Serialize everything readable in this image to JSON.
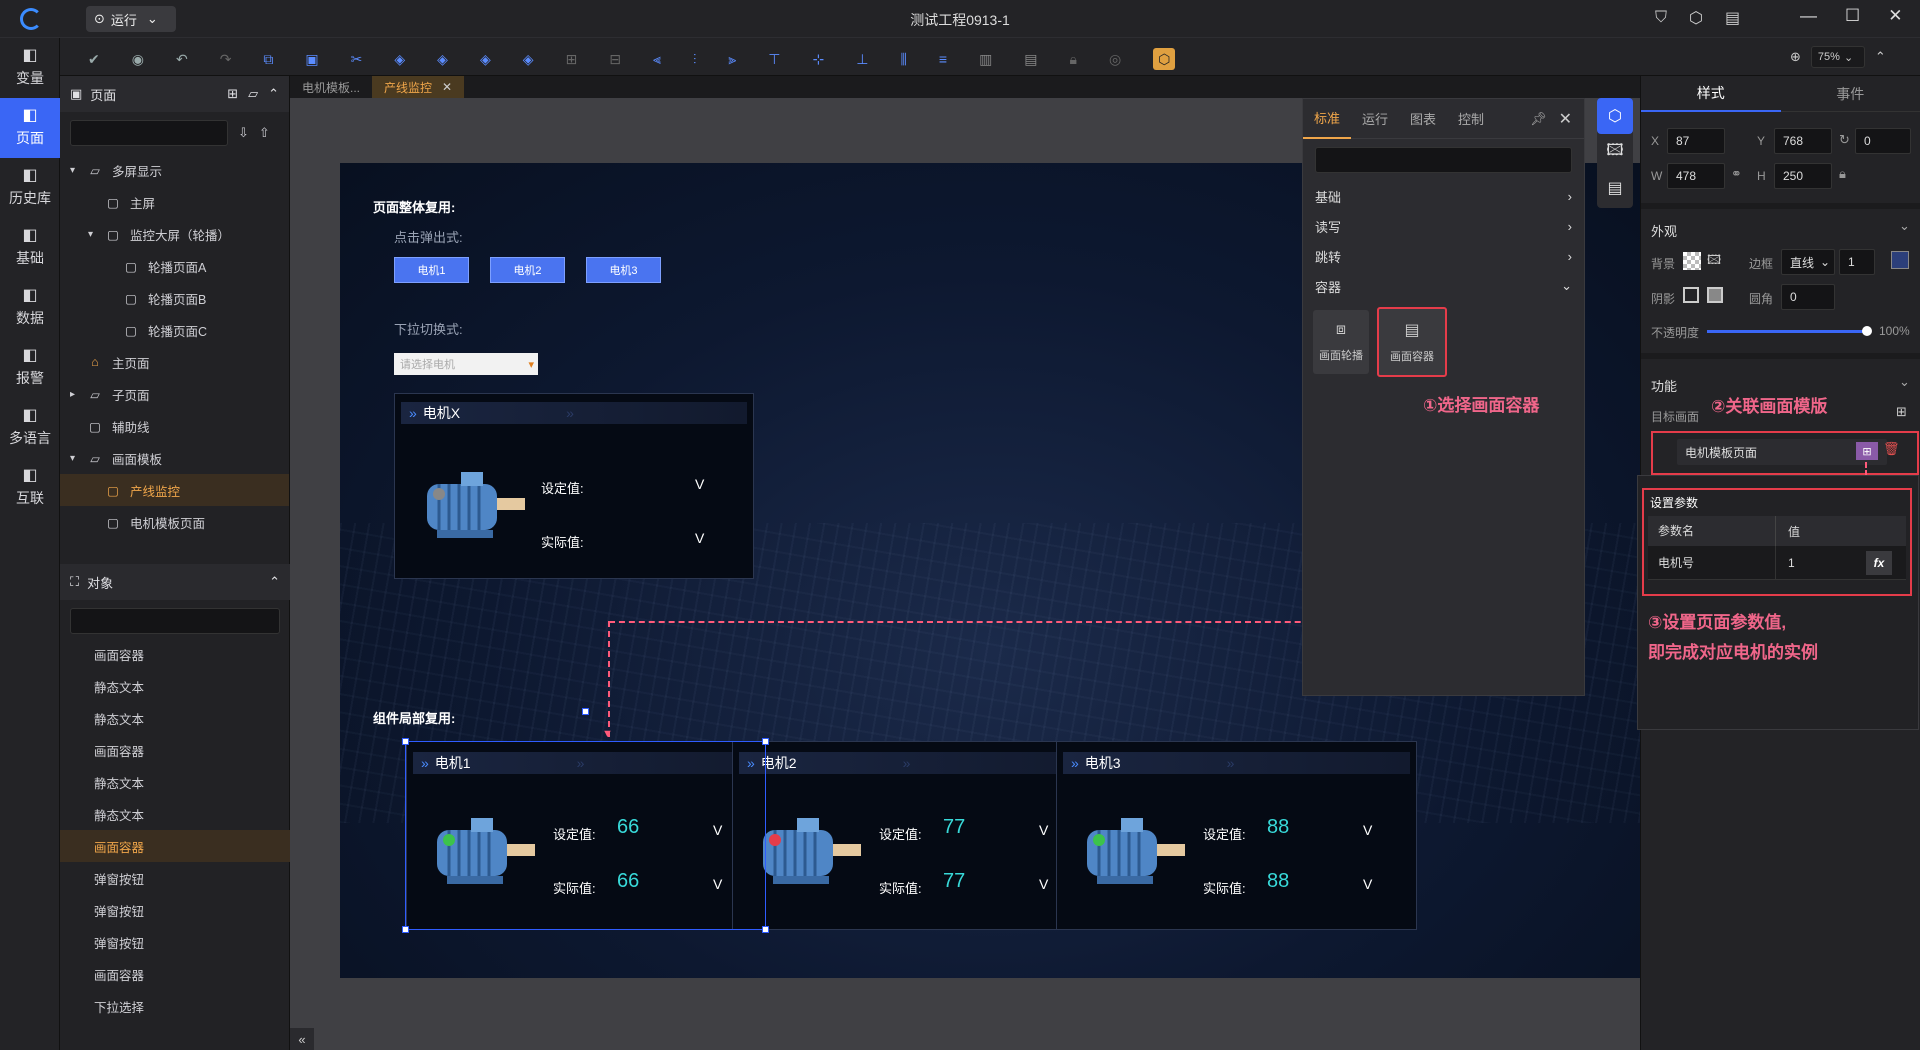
{
  "window": {
    "title": "测试工程0913-1",
    "run_label": "运行",
    "zoom": "75%"
  },
  "leftnav": [
    {
      "icon": "variable-icon",
      "label": "变量"
    },
    {
      "icon": "page-icon",
      "label": "页面",
      "active": true
    },
    {
      "icon": "history-icon",
      "label": "历史库"
    },
    {
      "icon": "basic-icon",
      "label": "基础"
    },
    {
      "icon": "data-icon",
      "label": "数据"
    },
    {
      "icon": "alarm-icon",
      "label": "报警"
    },
    {
      "icon": "language-icon",
      "label": "多语言"
    },
    {
      "icon": "connect-icon",
      "label": "互联"
    }
  ],
  "pages_panel": {
    "title": "页面",
    "tree": [
      {
        "label": "多屏显示",
        "level": 0,
        "arrow": "▾",
        "icon": "folder"
      },
      {
        "label": "主屏",
        "level": 1,
        "arrow": "",
        "icon": "page"
      },
      {
        "label": "监控大屏（轮播）",
        "level": 1,
        "arrow": "▾",
        "icon": "page"
      },
      {
        "label": "轮播页面A",
        "level": 2,
        "arrow": "",
        "icon": "page"
      },
      {
        "label": "轮播页面B",
        "level": 2,
        "arrow": "",
        "icon": "page"
      },
      {
        "label": "轮播页面C",
        "level": 2,
        "arrow": "",
        "icon": "page"
      },
      {
        "label": "主页面",
        "level": 0,
        "arrow": "",
        "icon": "home"
      },
      {
        "label": "子页面",
        "level": 0,
        "arrow": "▸",
        "icon": "folder"
      },
      {
        "label": "辅助线",
        "level": 0,
        "arrow": "",
        "icon": "page"
      },
      {
        "label": "画面模板",
        "level": 0,
        "arrow": "▾",
        "icon": "folder"
      },
      {
        "label": "产线监控",
        "level": 1,
        "arrow": "",
        "icon": "page",
        "selected": true
      },
      {
        "label": "电机模板页面",
        "level": 1,
        "arrow": "",
        "icon": "page"
      }
    ]
  },
  "objects_panel": {
    "title": "对象",
    "items": [
      {
        "label": "画面容器"
      },
      {
        "label": "静态文本"
      },
      {
        "label": "静态文本"
      },
      {
        "label": "画面容器"
      },
      {
        "label": "静态文本"
      },
      {
        "label": "静态文本"
      },
      {
        "label": "画面容器",
        "selected": true
      },
      {
        "label": "弹窗按钮"
      },
      {
        "label": "弹窗按钮"
      },
      {
        "label": "弹窗按钮"
      },
      {
        "label": "画面容器"
      },
      {
        "label": "下拉选择"
      }
    ]
  },
  "editor_tabs": [
    {
      "label": "电机模板...",
      "active": false
    },
    {
      "label": "产线监控",
      "active": true
    }
  ],
  "canvas": {
    "section1": "页面整体复用:",
    "popup_label": "点击弹出式:",
    "popup_buttons": [
      "电机1",
      "电机2",
      "电机3"
    ],
    "dropdown_label": "下拉切换式:",
    "dropdown_placeholder": "请选择电机",
    "template_card": {
      "title": "电机X",
      "set_label": "设定值:",
      "act_label": "实际值:",
      "unit": "V"
    },
    "section2": "组件局部复用:",
    "cards": [
      {
        "title": "电机1",
        "set_label": "设定值:",
        "set_value": "66",
        "act_label": "实际值:",
        "act_value": "66",
        "unit": "V",
        "status": "green"
      },
      {
        "title": "电机2",
        "set_label": "设定值:",
        "set_value": "77",
        "act_label": "实际值:",
        "act_value": "77",
        "unit": "V",
        "status": "red"
      },
      {
        "title": "电机3",
        "set_label": "设定值:",
        "set_value": "88",
        "act_label": "实际值:",
        "act_value": "88",
        "unit": "V",
        "status": "green"
      }
    ]
  },
  "component_panel": {
    "tabs": [
      "标准",
      "运行",
      "图表",
      "控制"
    ],
    "categories": [
      {
        "label": "基础",
        "arrow": "›"
      },
      {
        "label": "读写",
        "arrow": "›"
      },
      {
        "label": "跳转",
        "arrow": "›"
      },
      {
        "label": "容器",
        "arrow": "⌄"
      }
    ],
    "tiles": [
      "画面轮播",
      "画面容器"
    ]
  },
  "annotations": {
    "step1": "①选择画面容器",
    "step2": "②关联画面模版",
    "step3a": "③设置页面参数值,",
    "step3b": "即完成对应电机的实例"
  },
  "right_panel": {
    "tabs": [
      "样式",
      "事件"
    ],
    "x_label": "X",
    "x": "87",
    "y_label": "Y",
    "y": "768",
    "rotation": "0",
    "w_label": "W",
    "w": "478",
    "h_label": "H",
    "h": "250",
    "appearance": "外观",
    "bg_label": "背景",
    "border_label": "边框",
    "border_type": "直线",
    "border_width": "1",
    "shadow_label": "阴影",
    "radius_label": "圆角",
    "radius": "0",
    "opacity_label": "不透明度",
    "opacity": "100%",
    "function": "功能",
    "target_label": "目标画面",
    "target_value": "电机模板页面"
  },
  "param_dialog": {
    "title": "设置参数",
    "col_name": "参数名",
    "col_value": "值",
    "rows": [
      {
        "name": "电机号",
        "value": "1"
      }
    ],
    "fx": "fx"
  }
}
